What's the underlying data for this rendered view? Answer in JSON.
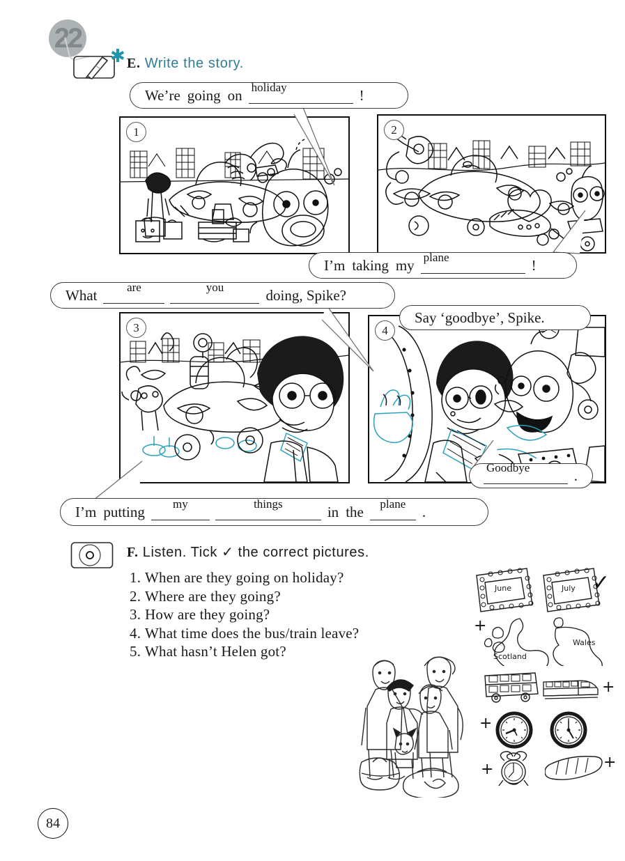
{
  "unit": {
    "number": "22"
  },
  "page": {
    "number": "84"
  },
  "exercise_e": {
    "letter": "E.",
    "title": "Write  the  story.",
    "icon": "pencil-icon",
    "panels": [
      {
        "number": "1"
      },
      {
        "number": "2"
      },
      {
        "number": "3"
      },
      {
        "number": "4"
      }
    ],
    "bubbles": [
      {
        "id": "bubble-1",
        "parts": [
          {
            "type": "text",
            "value": "We’re"
          },
          {
            "type": "text",
            "value": "going"
          },
          {
            "type": "text",
            "value": "on"
          },
          {
            "type": "blank",
            "value": "holiday"
          },
          {
            "type": "text",
            "value": "!"
          }
        ]
      },
      {
        "id": "bubble-2",
        "parts": [
          {
            "type": "text",
            "value": "I’m"
          },
          {
            "type": "text",
            "value": "taking"
          },
          {
            "type": "text",
            "value": "my"
          },
          {
            "type": "blank",
            "value": "plane"
          },
          {
            "type": "text",
            "value": "!"
          }
        ]
      },
      {
        "id": "bubble-3",
        "parts": [
          {
            "type": "text",
            "value": "What"
          },
          {
            "type": "blank",
            "value": "are"
          },
          {
            "type": "blank",
            "value": "you"
          },
          {
            "type": "text",
            "value": "doing,  Spike?"
          }
        ]
      },
      {
        "id": "bubble-4",
        "parts": [
          {
            "type": "text",
            "value": "Say  ‘goodbye’,  Spike."
          }
        ]
      },
      {
        "id": "bubble-5",
        "parts": [
          {
            "type": "blank",
            "value": "Goodbye"
          },
          {
            "type": "text",
            "value": "."
          }
        ]
      },
      {
        "id": "bubble-6",
        "parts": [
          {
            "type": "text",
            "value": "I’m"
          },
          {
            "type": "text",
            "value": "putting"
          },
          {
            "type": "blank",
            "value": "my"
          },
          {
            "type": "blank",
            "value": "things"
          },
          {
            "type": "text",
            "value": "in"
          },
          {
            "type": "text",
            "value": "the"
          },
          {
            "type": "blank",
            "value": "plane"
          },
          {
            "type": "text",
            "value": "."
          }
        ]
      }
    ]
  },
  "exercise_f": {
    "letter": "F.",
    "title": "Listen.  Tick  ✓  the  correct  pictures.",
    "icon": "cd-icon",
    "questions": [
      {
        "number": "1.",
        "text": "When  are  they  going  on  holiday?"
      },
      {
        "number": "2.",
        "text": "Where  are  they  going?"
      },
      {
        "number": "3.",
        "text": "How  are  they  going?"
      },
      {
        "number": "4.",
        "text": "What  time  does  the  bus/train  leave?"
      },
      {
        "number": "5.",
        "text": "What  hasn’t  Helen  got?"
      }
    ],
    "picture_options": [
      {
        "name": "calendar-june",
        "label": "June",
        "mark": ""
      },
      {
        "name": "calendar-july",
        "label": "July",
        "mark": "✓"
      },
      {
        "name": "map-scotland",
        "label": "Scotland",
        "mark": "+"
      },
      {
        "name": "map-wales",
        "label": "Wales",
        "mark": ""
      },
      {
        "name": "bus",
        "label": "",
        "mark": ""
      },
      {
        "name": "train",
        "label": "",
        "mark": "+"
      },
      {
        "name": "clock-one",
        "label": "",
        "mark": "+"
      },
      {
        "name": "clock-two",
        "label": "",
        "mark": ""
      },
      {
        "name": "alarm-clock",
        "label": "",
        "mark": "+"
      },
      {
        "name": "bread-loaf",
        "label": "",
        "mark": "+"
      }
    ],
    "illustration": "family-with-luggage"
  },
  "colors": {
    "heading_teal": "#2f7e94",
    "accent_cyan": "#1f94ab",
    "ink": "#111111",
    "badge_grey": "#9fa6a8"
  }
}
